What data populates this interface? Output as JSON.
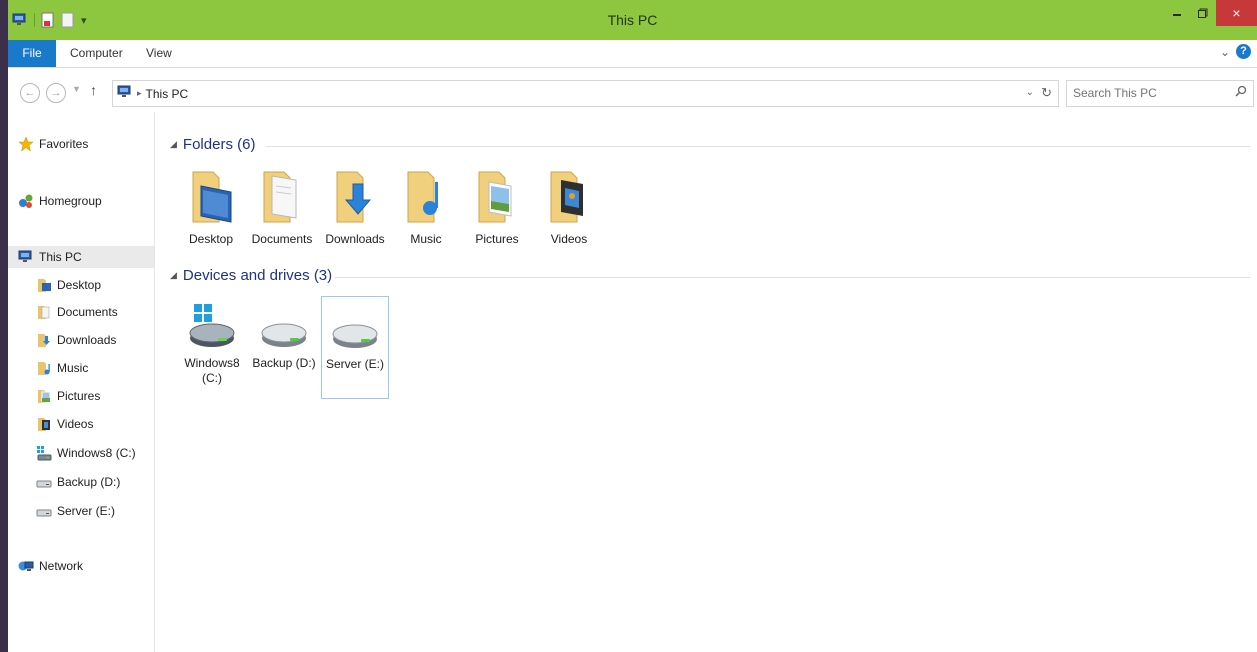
{
  "window": {
    "title": "This PC",
    "accent": "#8dc63f",
    "close_glyph": "×"
  },
  "ribbon": {
    "tabs": [
      "File",
      "Computer",
      "View"
    ]
  },
  "address": {
    "back_glyph": "←",
    "forward_glyph": "→",
    "up_glyph": "↑",
    "path_label": "This PC",
    "search_placeholder": "Search This PC"
  },
  "navigation": {
    "favorites": "Favorites",
    "homegroup": "Homegroup",
    "this_pc": "This PC",
    "this_pc_children": [
      "Desktop",
      "Documents",
      "Downloads",
      "Music",
      "Pictures",
      "Videos",
      "Windows8 (C:)",
      "Backup (D:)",
      "Server (E:)"
    ],
    "network": "Network"
  },
  "content": {
    "folders_header": "Folders (6)",
    "folders": [
      "Desktop",
      "Documents",
      "Downloads",
      "Music",
      "Pictures",
      "Videos"
    ],
    "drives_header": "Devices and drives (3)",
    "drives": [
      "Windows8 (C:)",
      "Backup (D:)",
      "Server (E:)"
    ],
    "selected_drive": "Server (E:)"
  }
}
